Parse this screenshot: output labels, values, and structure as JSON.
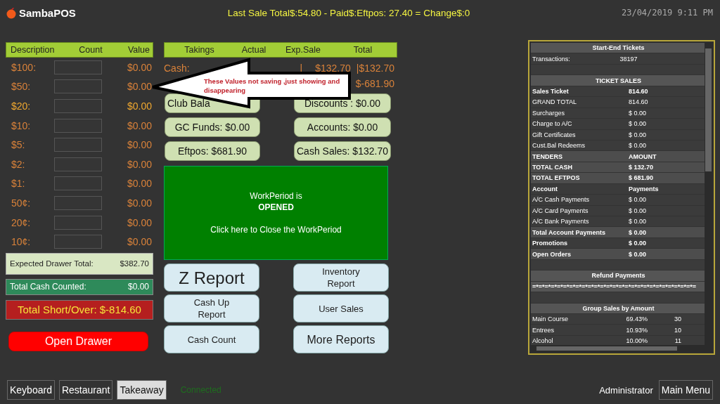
{
  "header": {
    "app_name": "SambaPOS",
    "last_sale": "Last Sale Total$:54.80 - Paid$:Eftpos: 27.40 = Change$:0",
    "datetime": "23/04/2019 9:11 PM"
  },
  "cash_count": {
    "columns": [
      "Description",
      "Count",
      "Value"
    ],
    "rows": [
      {
        "label": "$100:",
        "value": "$0.00",
        "highlighted": false
      },
      {
        "label": "$50:",
        "value": "$0.00",
        "highlighted": false
      },
      {
        "label": "$20:",
        "value": "$0.00",
        "highlighted": true
      },
      {
        "label": "$10:",
        "value": "$0.00",
        "highlighted": false
      },
      {
        "label": "$5:",
        "value": "$0.00",
        "highlighted": false
      },
      {
        "label": "$2:",
        "value": "$0.00",
        "highlighted": false
      },
      {
        "label": "$1:",
        "value": "$0.00",
        "highlighted": false
      },
      {
        "label": "50¢:",
        "value": "$0.00",
        "highlighted": false
      },
      {
        "label": "20¢:",
        "value": "$0.00",
        "highlighted": false
      },
      {
        "label": "10¢:",
        "value": "$0.00",
        "highlighted": false
      }
    ],
    "expected_label": "Expected Drawer Total:",
    "expected_value": "$382.70",
    "counted_label": "Total Cash Counted:",
    "counted_value": "$0.00",
    "short_over": "Total Short/Over: $-814.60",
    "open_drawer": "Open Drawer"
  },
  "takings": {
    "columns": [
      "Takings",
      "Actual",
      "Exp.Sale",
      "Total"
    ],
    "cash_row": {
      "label": "Cash:",
      "sep1": "|",
      "exp_sale": "$132.70",
      "sep2": "|",
      "total": "$132.70"
    },
    "eftpos_row": {
      "total": "$-681.90"
    },
    "buttons": [
      "Club Bala",
      "Discounts : $0.00",
      "GC Funds: $0.00",
      "Accounts: $0.00",
      "Eftpos: $681.90",
      "Cash Sales: $132.70"
    ],
    "work_period": {
      "line1": "WorkPeriod is",
      "status": "OPENED",
      "action": "Click here to Close the WorkPeriod"
    },
    "report_buttons": [
      {
        "label": "Z Report",
        "kind": "large"
      },
      {
        "label": "Inventory Report",
        "kind": "normal"
      },
      {
        "label": "Cash Up Report",
        "kind": "normal"
      },
      {
        "label": "User Sales",
        "kind": "normal"
      },
      {
        "label": "Cash Count",
        "kind": "normal"
      },
      {
        "label": "More Reports",
        "kind": "medium"
      }
    ]
  },
  "annotation": {
    "text": "These Values not saving ,just showing and disappearing"
  },
  "report": {
    "rows": [
      {
        "kind": "title",
        "cells": [
          "Start-End Tickets"
        ]
      },
      {
        "kind": "triple",
        "cells": [
          "Transactions:",
          "38197"
        ]
      },
      {
        "kind": "blank",
        "cells": []
      },
      {
        "kind": "title",
        "cells": [
          "TICKET SALES"
        ]
      },
      {
        "kind": "bold",
        "cells": [
          "Sales Ticket",
          "814.60"
        ]
      },
      {
        "kind": "normal",
        "cells": [
          "GRAND TOTAL",
          "814.60"
        ]
      },
      {
        "kind": "normal",
        "cells": [
          "Surcharges",
          "$ 0.00"
        ]
      },
      {
        "kind": "normal",
        "cells": [
          "Charge to A/C",
          "$ 0.00"
        ]
      },
      {
        "kind": "normal",
        "cells": [
          "Gift Certificates",
          "$ 0.00"
        ]
      },
      {
        "kind": "normal",
        "cells": [
          "Cust.Bal Redeems",
          "$ 0.00"
        ]
      },
      {
        "kind": "strong",
        "cells": [
          "TENDERS",
          "AMOUNT"
        ]
      },
      {
        "kind": "strong",
        "cells": [
          "TOTAL CASH",
          "$ 132.70"
        ]
      },
      {
        "kind": "strong",
        "cells": [
          "TOTAL EFTPOS",
          "$ 681.90"
        ]
      },
      {
        "kind": "bold",
        "cells": [
          "Account",
          "Payments"
        ]
      },
      {
        "kind": "normal",
        "cells": [
          "A/C Cash Payments",
          "$ 0.00"
        ]
      },
      {
        "kind": "normal",
        "cells": [
          "A/C Card Payments",
          "$ 0.00"
        ]
      },
      {
        "kind": "normal",
        "cells": [
          "A/C Bank Payments",
          "$ 0.00"
        ]
      },
      {
        "kind": "strong",
        "cells": [
          "Total Account Payments",
          "$ 0.00"
        ]
      },
      {
        "kind": "bold",
        "cells": [
          "Promotions",
          "$ 0.00"
        ]
      },
      {
        "kind": "strong",
        "cells": [
          "Open Orders",
          "$ 0.00"
        ]
      },
      {
        "kind": "blank",
        "cells": []
      },
      {
        "kind": "title",
        "cells": [
          "Refund Payments"
        ]
      },
      {
        "kind": "pattern",
        "cells": [
          "=*=*=*=*=*=*=*=*=*=*=*=*=*=*=*=*=*=*=*=*=*=*=*=*=*=*="
        ]
      },
      {
        "kind": "blank",
        "cells": []
      },
      {
        "kind": "title",
        "cells": [
          "Group Sales by Amount"
        ]
      },
      {
        "kind": "group",
        "cells": [
          "Main Course",
          "69.43%",
          "30"
        ]
      },
      {
        "kind": "group",
        "cells": [
          "Entrees",
          "10.93%",
          "10"
        ]
      },
      {
        "kind": "group",
        "cells": [
          "Alcohol",
          "10.00%",
          "11"
        ]
      }
    ]
  },
  "footer": {
    "tabs": [
      {
        "label": "Keyboard",
        "selected": false
      },
      {
        "label": "Restaurant",
        "selected": false
      },
      {
        "label": "Takeaway",
        "selected": true
      }
    ],
    "status": "Connected",
    "user": "Administrator",
    "main_menu": "Main Menu"
  }
}
